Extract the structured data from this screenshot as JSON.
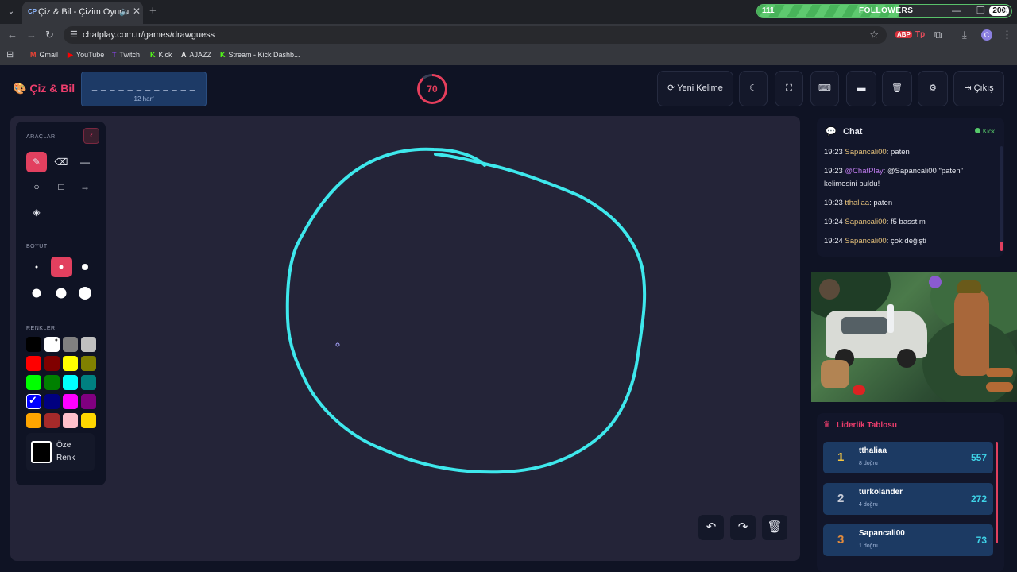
{
  "browser": {
    "tab_title": "Çiz & Bil - Çizim Oyunu",
    "tab_fav": "CP",
    "followers_left": "111",
    "followers_label": "FOLLOWERS",
    "followers_goal": "200",
    "followers_progress": 0.555,
    "url": "chatplay.com.tr/games/drawguess",
    "avatar_letter": "C",
    "ext_abp": "ABP",
    "ext_tp": "Tp",
    "bookmarks": [
      {
        "label": "Gmail",
        "icon": "M",
        "color": "#ea4335"
      },
      {
        "label": "YouTube",
        "icon": "▶",
        "color": "#ff0000"
      },
      {
        "label": "Twitch",
        "icon": "T",
        "color": "#9146ff"
      },
      {
        "label": "Kick",
        "icon": "K",
        "color": "#53fc18"
      },
      {
        "label": "AJAZZ",
        "icon": "A",
        "color": "#e8e8e8"
      },
      {
        "label": "Stream - Kick Dashb...",
        "icon": "K",
        "color": "#53fc18"
      }
    ]
  },
  "header": {
    "logo": "Çiz & Bil",
    "word_dashes": "_ _ _ _ _ _ _ _ _ _ _ _",
    "word_count": "12 harf",
    "timer": "70",
    "new_word": "Yeni Kelime",
    "exit": "Çıkış"
  },
  "tools": {
    "title": "ARAÇLAR",
    "size_title": "BOYUT",
    "colors_title": "RENKLER",
    "custom_label_1": "Özel",
    "custom_label_2": "Renk",
    "colors": [
      "#000000",
      "#ffffff",
      "#808080",
      "#c0c0c0",
      "#ff0000",
      "#800000",
      "#ffff00",
      "#808000",
      "#00ff00",
      "#008000",
      "#00ffff",
      "#008080",
      "#0000ff",
      "#000080",
      "#ff00ff",
      "#800080",
      "#ffa500",
      "#a52a2a",
      "#ffc0cb",
      "#ffd700"
    ]
  },
  "chat": {
    "title": "Chat",
    "source": "Kick",
    "messages": [
      {
        "time": "19:23",
        "user": "Sapancali00",
        "text": "paten"
      },
      {
        "time": "19:23",
        "user": "@ChatPlay",
        "text": "@Sapancali00 \"paten\" kelimesini buldu!"
      },
      {
        "time": "19:23",
        "user": "tthaliaa",
        "text": "paten"
      },
      {
        "time": "19:24",
        "user": "Sapancali00",
        "text": "f5 basstım"
      },
      {
        "time": "19:24",
        "user": "Sapancali00",
        "text": "çok değişti"
      }
    ]
  },
  "leaderboard": {
    "title": "Liderlik Tablosu",
    "rows": [
      {
        "rank": "1",
        "name": "tthaliaa",
        "sub": "8 doğru",
        "score": "557",
        "rank_color": "#f5c542"
      },
      {
        "rank": "2",
        "name": "turkolander",
        "sub": "4 doğru",
        "score": "272",
        "rank_color": "#c7cbd6"
      },
      {
        "rank": "3",
        "name": "Sapancali00",
        "sub": "1 doğru",
        "score": "73",
        "rank_color": "#e08a3c"
      }
    ]
  },
  "colors": {
    "accent": "#e2405f",
    "brush_stroke": "#3ee8ec",
    "canvas_bg": "#242438"
  }
}
